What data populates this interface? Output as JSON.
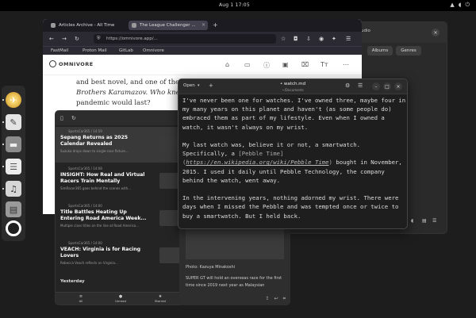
{
  "topbar": {
    "clock": "Aug 1  17:05",
    "tray": [
      "network-icon",
      "volume-icon",
      "power-icon"
    ]
  },
  "dock": {
    "apps": [
      {
        "name": "compass-icon",
        "color": "#f0c040"
      },
      {
        "name": "notes-icon",
        "color": "#d9d9d9"
      },
      {
        "name": "folder-icon",
        "color": "#8a8a8a"
      },
      {
        "name": "document-icon",
        "color": "#e0e0e0"
      },
      {
        "name": "music-icon",
        "color": "#d0d0d0"
      },
      {
        "name": "archive-icon",
        "color": "#9a9a9a"
      },
      {
        "name": "help-icon",
        "color": "#ffffff"
      }
    ]
  },
  "music": {
    "partial_label": "udio",
    "albums_label": "Albums",
    "genres_label": "Genres",
    "close_symbol": "×"
  },
  "browser": {
    "tabs": [
      {
        "label": "Articles Archive - All Time"
      },
      {
        "label": "The League Challenger ..."
      }
    ],
    "url": "https://omnivore.app/...",
    "bookmarks": [
      "FastMail",
      "Proton Mail",
      "GitLab",
      "Omnivore"
    ],
    "logo": "OMNIVORE",
    "article_lines": [
      "and best novel, and one of the",
      "Brothers Karamazov. Who knew",
      "pandemic would last?"
    ]
  },
  "reader": {
    "items": [
      {
        "meta": "SportsCar365 / 14:59",
        "title": "Sepang Returns as 2025 Calendar Revealed",
        "desc": "Suzuka drops down to single-race fixture..."
      },
      {
        "meta": "SportsCar365 / 14:08",
        "title": "INSIGHT: How Real and Virtual Racers Train Mentally",
        "desc": "SimRacer365 goes behind the scenes with..."
      },
      {
        "meta": "SportsCar365 / 14:00",
        "title": "Title Battles Heating Up Entering Road America Week...",
        "desc": "Multiple class titles on the line at Road America..."
      },
      {
        "meta": "SportsCar365 / 14:00",
        "title": "VEACH: Virginia is for Racing Lovers",
        "desc": "Rebecca Veach reflects on Virginia..."
      }
    ],
    "section": "Yesterday",
    "footer_tabs": [
      "All",
      "Unread",
      "Starred"
    ]
  },
  "pane": {
    "credit": "Photo: Kazuya Minakoshi",
    "body": "SUPER GT will hold an overseas race for the first time since 2019 next year as Malaysian"
  },
  "editor": {
    "open_label": "Open",
    "filename": "• watch.md",
    "path": "~/Documents",
    "para1": "I've never been one for watches. I've owned three, maybe four in my many years on this planet and haven't (as some people do) embraced them as part of my lifestyle. Even when I owned a watch, it wasn't always on my wrist.",
    "para2_pre": "My last watch was, believe it or not, a smartwatch. Specifically, a ",
    "para2_bracket": "[Pebble Time](",
    "para2_link": "https://en.wikipedia.org/wiki/Pebble_Time",
    "para2_close": ")",
    "para2_post": " bought in November, 2015. I used it daily until Pebble Technology, the company behind the watch, went away.",
    "para3": "In the intervening years, nothing adorned my wrist. There were days when I missed the Pebble and was tempted once or twice to buy a smartwatch. But I held back."
  }
}
